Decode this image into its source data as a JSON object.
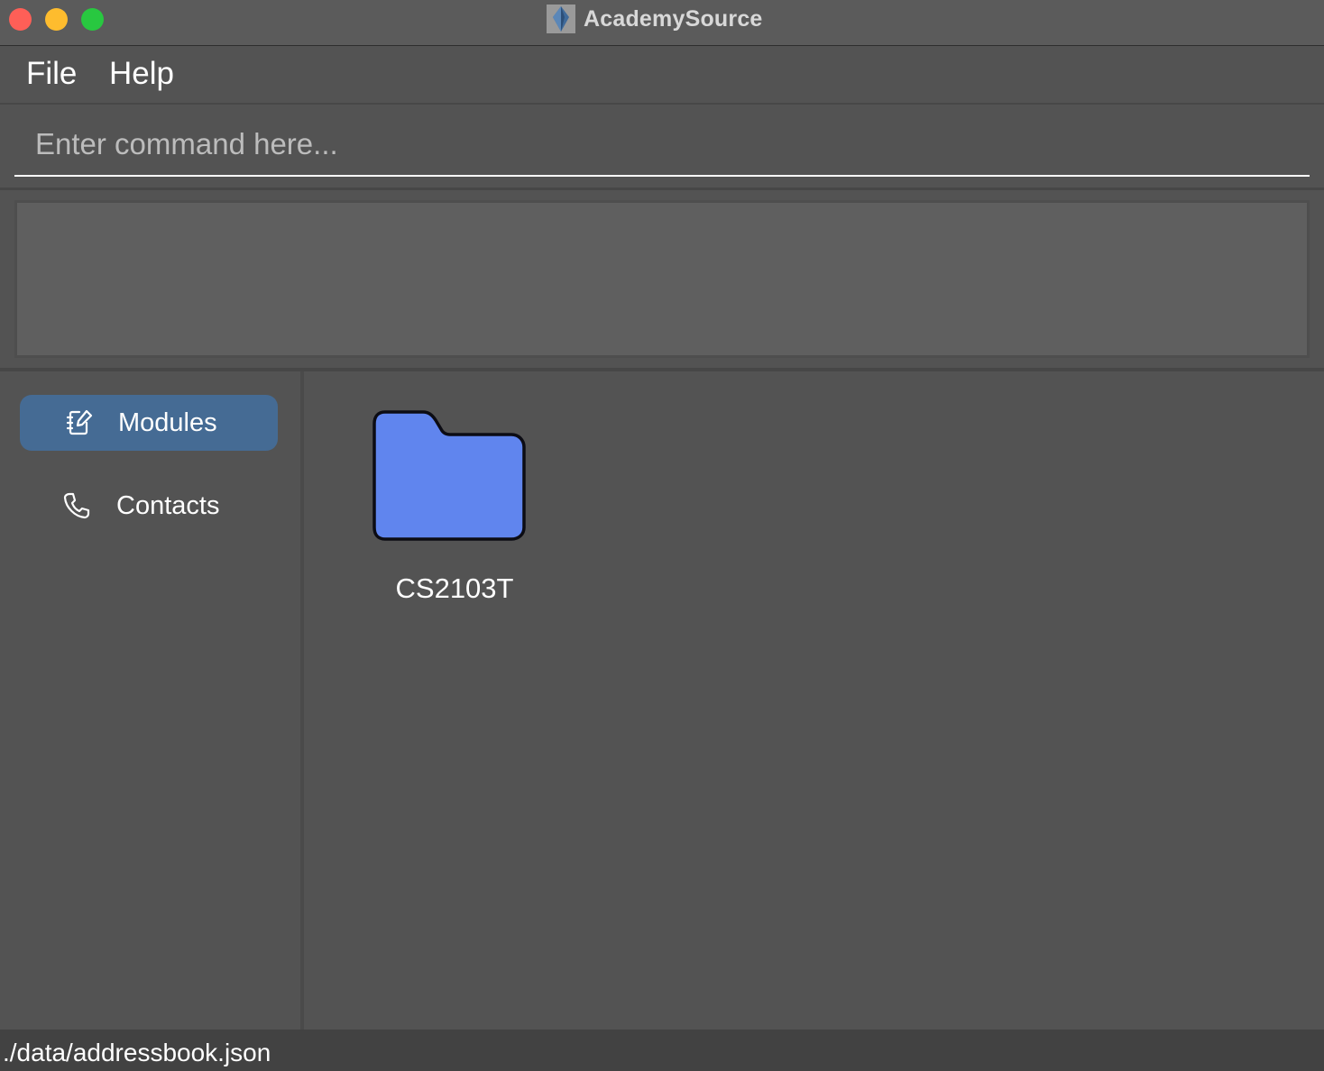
{
  "window": {
    "title": "AcademySource",
    "app_icon": "academysource-logo-icon",
    "controls": [
      "close",
      "minimize",
      "maximize"
    ]
  },
  "menu": {
    "file_label": "File",
    "help_label": "Help"
  },
  "command": {
    "value": "",
    "placeholder": "Enter command here..."
  },
  "result": {
    "text": ""
  },
  "sidebar": {
    "items": [
      {
        "label": "Modules",
        "icon": "notebook-edit-icon",
        "selected": true
      },
      {
        "label": "Contacts",
        "icon": "phone-icon",
        "selected": false
      }
    ]
  },
  "modules": [
    {
      "name": "CS2103T",
      "icon": "folder-icon"
    }
  ],
  "status": {
    "path": "./data/addressbook.json"
  },
  "colors": {
    "accent_selected": "#456b94",
    "folder_fill": "#6085ee",
    "background": "#535353"
  }
}
